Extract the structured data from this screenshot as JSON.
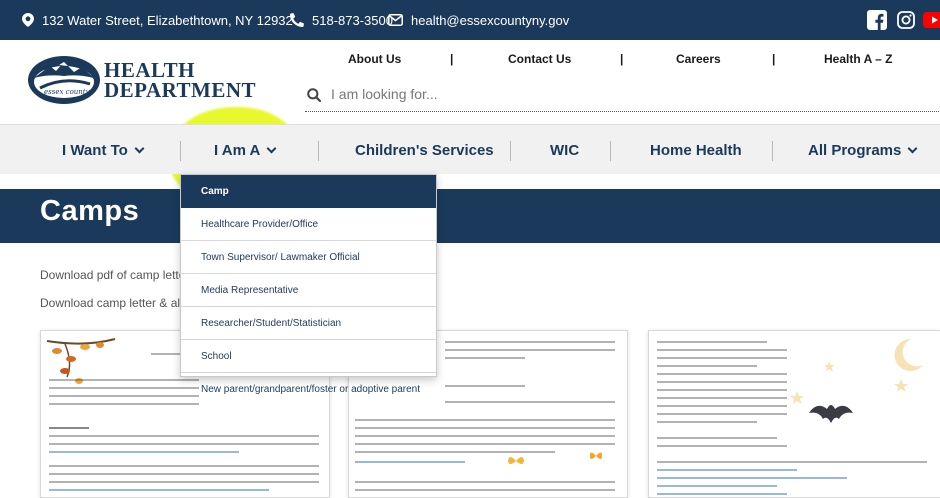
{
  "topbar": {
    "address": "132 Water Street, Elizabethtown, NY 12932",
    "phone": "518-873-3500",
    "email": "health@essexcountyny.gov",
    "social": [
      {
        "icon": "facebook-icon"
      },
      {
        "icon": "instagram-icon"
      },
      {
        "icon": "youtube-icon"
      }
    ]
  },
  "logo": {
    "line1": "HEALTH",
    "line2": "DEPARTMENT",
    "badge": "essex county"
  },
  "toplinks": [
    "About Us",
    "|",
    "Contact Us",
    "|",
    "Careers",
    "|",
    "Health A – Z"
  ],
  "search": {
    "placeholder": "I am looking for..."
  },
  "mainnav": {
    "items": [
      "I Want To",
      "I Am A",
      "Children's Services",
      "WIC",
      "Home Health",
      "All Programs"
    ]
  },
  "dropdown": {
    "items": [
      "Camp",
      "Healthcare Provider/Office",
      "Town Supervisor/ Lawmaker Official",
      "Media Representative",
      "Researcher/Student/Statistician",
      "School",
      "New parent/grandparent/foster or adoptive parent"
    ]
  },
  "page": {
    "title": "Camps",
    "para1": "Download pdf of camp lette",
    "para2": "Download camp letter & all t"
  },
  "colors": {
    "navy": "#1b3a5b",
    "highlight": "#e2f800",
    "youtube": "#ff0000"
  }
}
